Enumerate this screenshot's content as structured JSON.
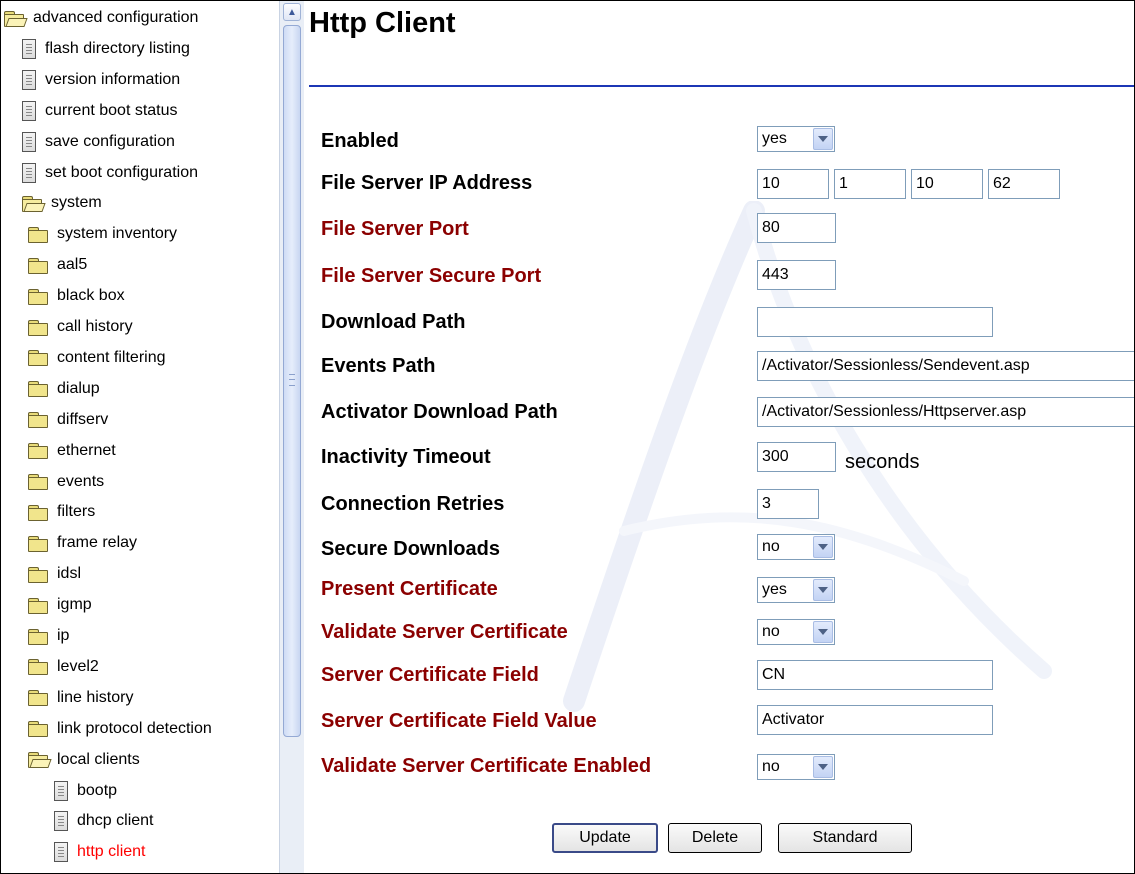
{
  "tree": [
    {
      "label": "advanced configuration",
      "icon": "folder-open-icon",
      "depth": 0
    },
    {
      "label": "flash directory listing",
      "icon": "document-icon",
      "depth": 1
    },
    {
      "label": "version information",
      "icon": "document-icon",
      "depth": 1
    },
    {
      "label": "current boot status",
      "icon": "document-icon",
      "depth": 1
    },
    {
      "label": "save configuration",
      "icon": "document-icon",
      "depth": 1
    },
    {
      "label": "set boot configuration",
      "icon": "document-icon",
      "depth": 1
    },
    {
      "label": "system",
      "icon": "folder-open-icon",
      "depth": 1
    },
    {
      "label": "system inventory",
      "icon": "folder-icon",
      "depth": 2
    },
    {
      "label": "aal5",
      "icon": "folder-icon",
      "depth": 2
    },
    {
      "label": "black box",
      "icon": "folder-icon",
      "depth": 2
    },
    {
      "label": "call history",
      "icon": "folder-icon",
      "depth": 2
    },
    {
      "label": "content filtering",
      "icon": "folder-icon",
      "depth": 2
    },
    {
      "label": "dialup",
      "icon": "folder-icon",
      "depth": 2
    },
    {
      "label": "diffserv",
      "icon": "folder-icon",
      "depth": 2
    },
    {
      "label": "ethernet",
      "icon": "folder-icon",
      "depth": 2
    },
    {
      "label": "events",
      "icon": "folder-icon",
      "depth": 2
    },
    {
      "label": "filters",
      "icon": "folder-icon",
      "depth": 2
    },
    {
      "label": "frame relay",
      "icon": "folder-icon",
      "depth": 2
    },
    {
      "label": "idsl",
      "icon": "folder-icon",
      "depth": 2
    },
    {
      "label": "igmp",
      "icon": "folder-icon",
      "depth": 2
    },
    {
      "label": "ip",
      "icon": "folder-icon",
      "depth": 2
    },
    {
      "label": "level2",
      "icon": "folder-icon",
      "depth": 2
    },
    {
      "label": "line history",
      "icon": "folder-icon",
      "depth": 2
    },
    {
      "label": "link protocol detection",
      "icon": "folder-icon",
      "depth": 2
    },
    {
      "label": "local clients",
      "icon": "folder-open-icon",
      "depth": 2
    },
    {
      "label": "bootp",
      "icon": "document-icon",
      "depth": 3
    },
    {
      "label": "dhcp client",
      "icon": "document-icon",
      "depth": 3
    },
    {
      "label": "http client",
      "icon": "document-icon",
      "depth": 3,
      "active": true
    }
  ],
  "page": {
    "title": "Http Client"
  },
  "form": {
    "enabled": {
      "label": "Enabled",
      "value": "yes"
    },
    "file_server_ip": {
      "label": "File Server IP Address",
      "octets": [
        "10",
        "1",
        "10",
        "62"
      ]
    },
    "file_server_port": {
      "label": "File Server Port",
      "value": "80"
    },
    "file_server_secure_port": {
      "label": "File Server Secure Port",
      "value": "443"
    },
    "download_path": {
      "label": "Download Path",
      "value": ""
    },
    "events_path": {
      "label": "Events Path",
      "value": "/Activator/Sessionless/Sendevent.asp"
    },
    "activator_download_path": {
      "label": "Activator Download Path",
      "value": "/Activator/Sessionless/Httpserver.asp"
    },
    "inactivity_timeout": {
      "label": "Inactivity Timeout",
      "value": "300",
      "unit": "seconds"
    },
    "connection_retries": {
      "label": "Connection Retries",
      "value": "3"
    },
    "secure_downloads": {
      "label": "Secure Downloads",
      "value": "no"
    },
    "present_certificate": {
      "label": "Present Certificate",
      "value": "yes"
    },
    "validate_server_certificate": {
      "label": "Validate Server Certificate",
      "value": "no"
    },
    "server_certificate_field": {
      "label": "Server Certificate Field",
      "value": "CN"
    },
    "server_certificate_field_value": {
      "label": "Server Certificate Field Value",
      "value": "Activator"
    },
    "validate_server_certificate_enabled": {
      "label": "Validate Server Certificate Enabled",
      "value": "no"
    }
  },
  "buttons": {
    "update": "Update",
    "delete": "Delete",
    "standard": "Standard"
  },
  "colors": {
    "label_red": "#8b0000",
    "rule_blue": "#1c36b5",
    "active_link": "#ff0000"
  }
}
